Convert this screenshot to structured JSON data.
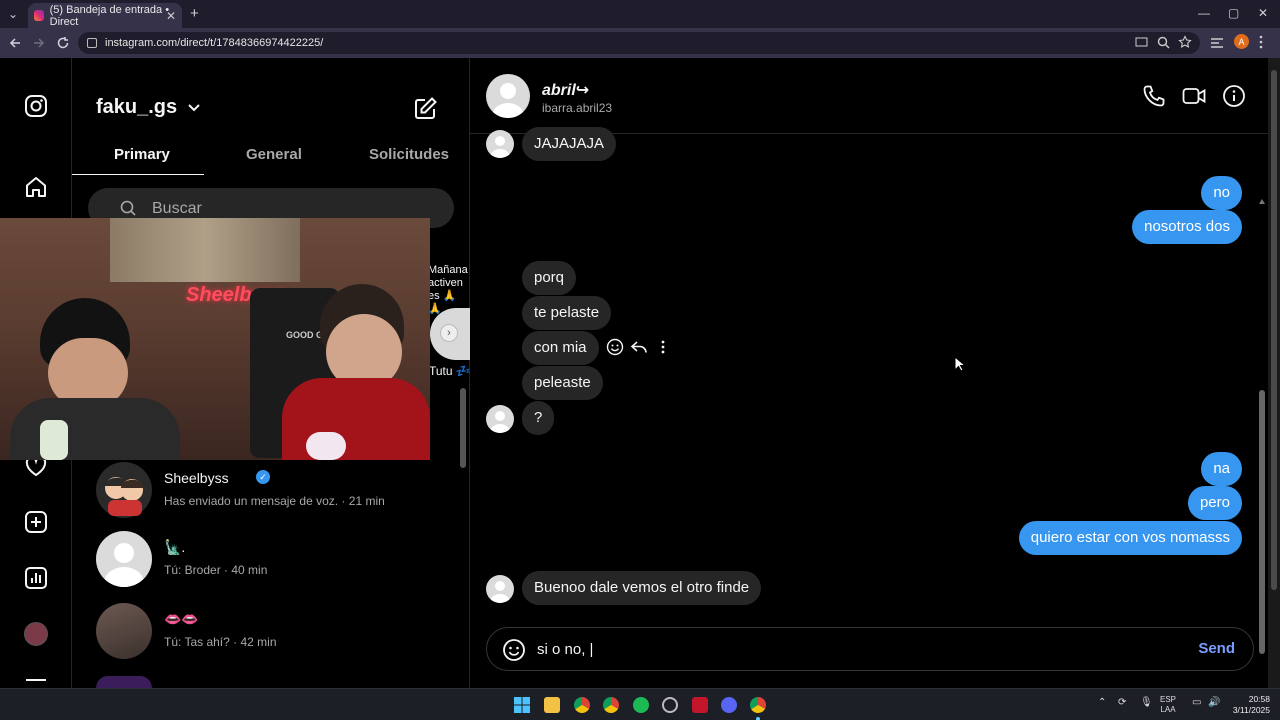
{
  "browser": {
    "tab_title": "(5) Bandeja de entrada • Direct",
    "url": "instagram.com/direct/t/17848366974422225/",
    "profile_initial": "A",
    "new_tab": "+",
    "tab_close": "✕",
    "win_min": "—",
    "win_max": "▢",
    "win_close": "✕"
  },
  "inbox": {
    "username": "faku_.gs",
    "tabs": [
      "Primary",
      "General",
      "Solicitudes"
    ],
    "search_placeholder": "Buscar",
    "stories_partial": {
      "note": "Mañana activen es 🙏🙏",
      "name": "Tutu 💤"
    },
    "conversations": [
      {
        "name": "Sheelbyss",
        "verified": true,
        "preview": "Has enviado un mensaje de voz. · 21 min"
      },
      {
        "name": "🗽.",
        "preview": "Tú: Broder · 40 min"
      },
      {
        "name": "👄👄",
        "preview": "Tú: Tas ahí? · 42 min"
      }
    ]
  },
  "webcam": {
    "sign": "Sheelbyss",
    "chair_label": "GOOD GAM"
  },
  "chat": {
    "display_name": "abril↪",
    "handle": "ibarra.abril23",
    "messages": [
      {
        "dir": "in",
        "text": "JAJAJAJA"
      },
      {
        "dir": "out",
        "text": "no"
      },
      {
        "dir": "out",
        "text": "nosotros dos"
      },
      {
        "dir": "in",
        "text": "porq"
      },
      {
        "dir": "in",
        "text": "te pelaste"
      },
      {
        "dir": "in",
        "text": "con mia"
      },
      {
        "dir": "in",
        "text": "peleaste"
      },
      {
        "dir": "in",
        "text": "?"
      },
      {
        "dir": "out",
        "text": "na"
      },
      {
        "dir": "out",
        "text": "pero"
      },
      {
        "dir": "out",
        "text": "quiero estar con vos nomasss"
      },
      {
        "dir": "in",
        "text": "Buenoo dale vemos el otro finde"
      }
    ],
    "composer_value": "si o no, |",
    "send_label": "Send"
  },
  "taskbar": {
    "lang_top": "ESP",
    "lang_bottom": "LAA",
    "time": "20:58",
    "date": "3/11/2025"
  },
  "colors": {
    "outgoing": "#3797f0",
    "incoming": "#262626",
    "send": "#7a9eff"
  }
}
